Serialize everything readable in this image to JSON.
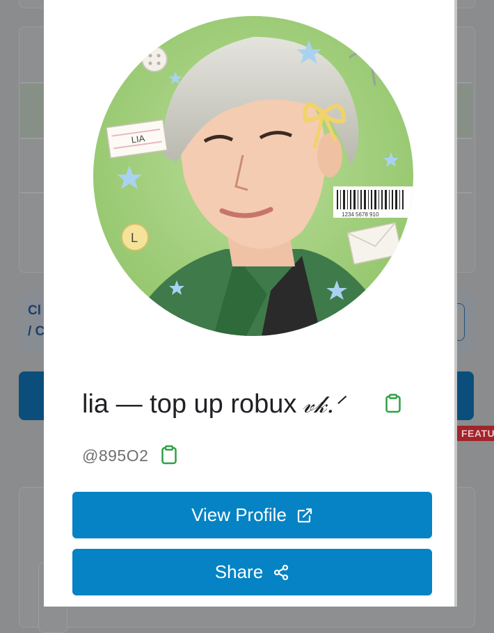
{
  "background": {
    "partial_texts": [
      "Cl",
      "/ C"
    ],
    "ribbon_label": "FEATUR"
  },
  "profile": {
    "display_name": "lia — top up robux",
    "signature": "𝓋𝓀.ᐟ",
    "username": "@895O2",
    "avatar_label": "LIA",
    "avatar_barcode": "1234 5678 910",
    "avatar_badge": "L"
  },
  "actions": {
    "view_profile_label": "View Profile",
    "share_label": "Share"
  },
  "colors": {
    "button": "#0583c4",
    "copy_icon": "#2ea043",
    "avatar_bg": "#9ccc7a"
  },
  "icons": {
    "copy": "clipboard-icon",
    "external": "external-link-icon",
    "share": "share-icon"
  }
}
